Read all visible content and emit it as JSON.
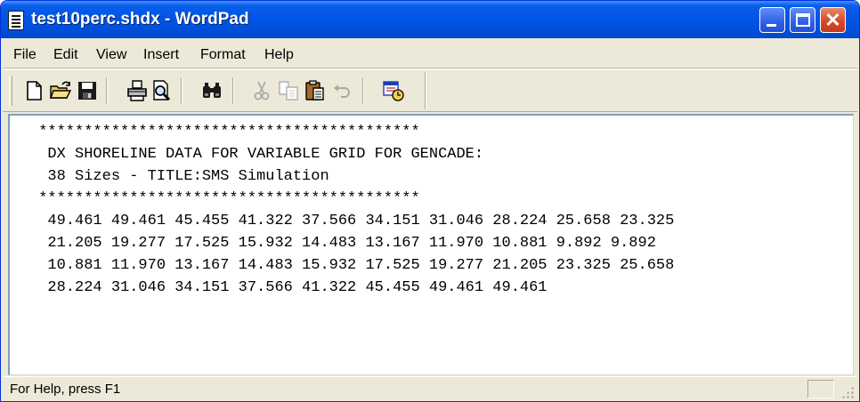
{
  "window": {
    "title": "test10perc.shdx - WordPad"
  },
  "menu": {
    "items": [
      "File",
      "Edit",
      "View",
      "Insert",
      "Format",
      "Help"
    ]
  },
  "toolbar": {
    "tools": [
      "new-document-icon",
      "open-folder-icon",
      "save-disk-icon",
      "print-icon",
      "print-preview-icon",
      "find-binoculars-icon",
      "cut-scissors-icon",
      "copy-icon",
      "paste-icon",
      "undo-icon",
      "insert-datetime-icon"
    ]
  },
  "document": {
    "lines": [
      " ******************************************",
      "  DX SHORELINE DATA FOR VARIABLE GRID FOR GENCADE:",
      "  38 Sizes - TITLE:SMS Simulation",
      " ******************************************",
      "  49.461 49.461 45.455 41.322 37.566 34.151 31.046 28.224 25.658 23.325",
      "  21.205 19.277 17.525 15.932 14.483 13.167 11.970 10.881 9.892 9.892",
      "  10.881 11.970 13.167 14.483 15.932 17.525 19.277 21.205 23.325 25.658",
      "  28.224 31.046 34.151 37.566 41.322 45.455 49.461 49.461"
    ]
  },
  "status": {
    "text": "For Help, press F1"
  },
  "colors": {
    "titlebar": "#0055e5",
    "close_button": "#d6492a",
    "chrome": "#ece9d8"
  }
}
